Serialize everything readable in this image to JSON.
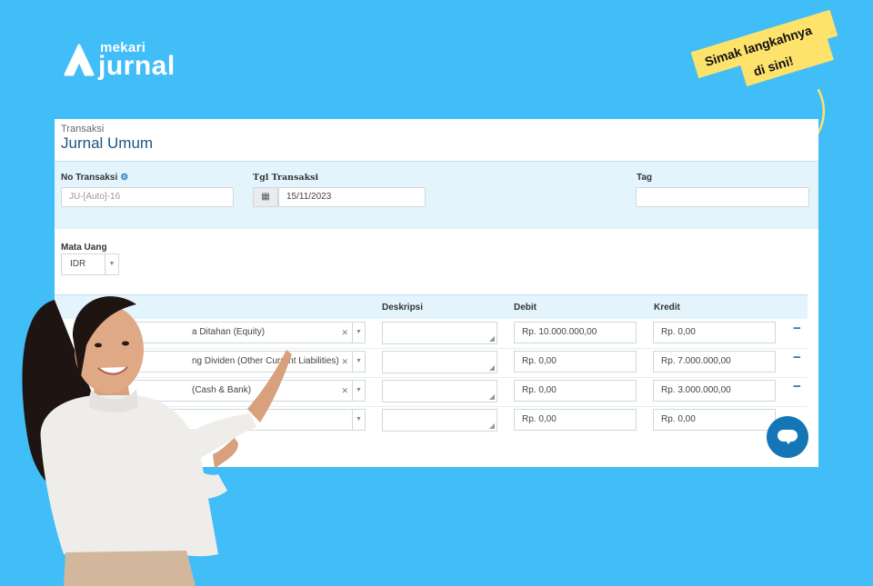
{
  "brand": {
    "small": "mekari",
    "big": "jurnal"
  },
  "sticker": {
    "line1": "Simak langkahnya",
    "line2": "di sini!"
  },
  "page": {
    "breadcrumb": "Transaksi",
    "title": "Jurnal Umum"
  },
  "form": {
    "no_transaksi_label": "No Transaksi",
    "no_transaksi_placeholder": "JU-[Auto]-16",
    "tgl_label": "Tgl Transaksi",
    "tgl_value": "15/11/2023",
    "tag_label": "Tag",
    "currency_label": "Mata Uang",
    "currency_value": "IDR"
  },
  "table": {
    "headers": {
      "deskripsi": "Deskripsi",
      "debit": "Debit",
      "kredit": "Kredit"
    },
    "rows": [
      {
        "account": "a Ditahan (Equity)",
        "debit": "Rp. 10.000.000,00",
        "kredit": "Rp. 0,00"
      },
      {
        "account": "ng Dividen (Other Current Liabilities)",
        "debit": "Rp. 0,00",
        "kredit": "Rp. 7.000.000,00"
      },
      {
        "account": "(Cash & Bank)",
        "debit": "Rp. 0,00",
        "kredit": "Rp. 3.000.000,00"
      },
      {
        "account": "",
        "debit": "Rp. 0,00",
        "kredit": "Rp. 0,00"
      }
    ]
  },
  "colors": {
    "background": "#41bdf8",
    "accent": "#1576b7",
    "sticker": "#fde26c"
  }
}
